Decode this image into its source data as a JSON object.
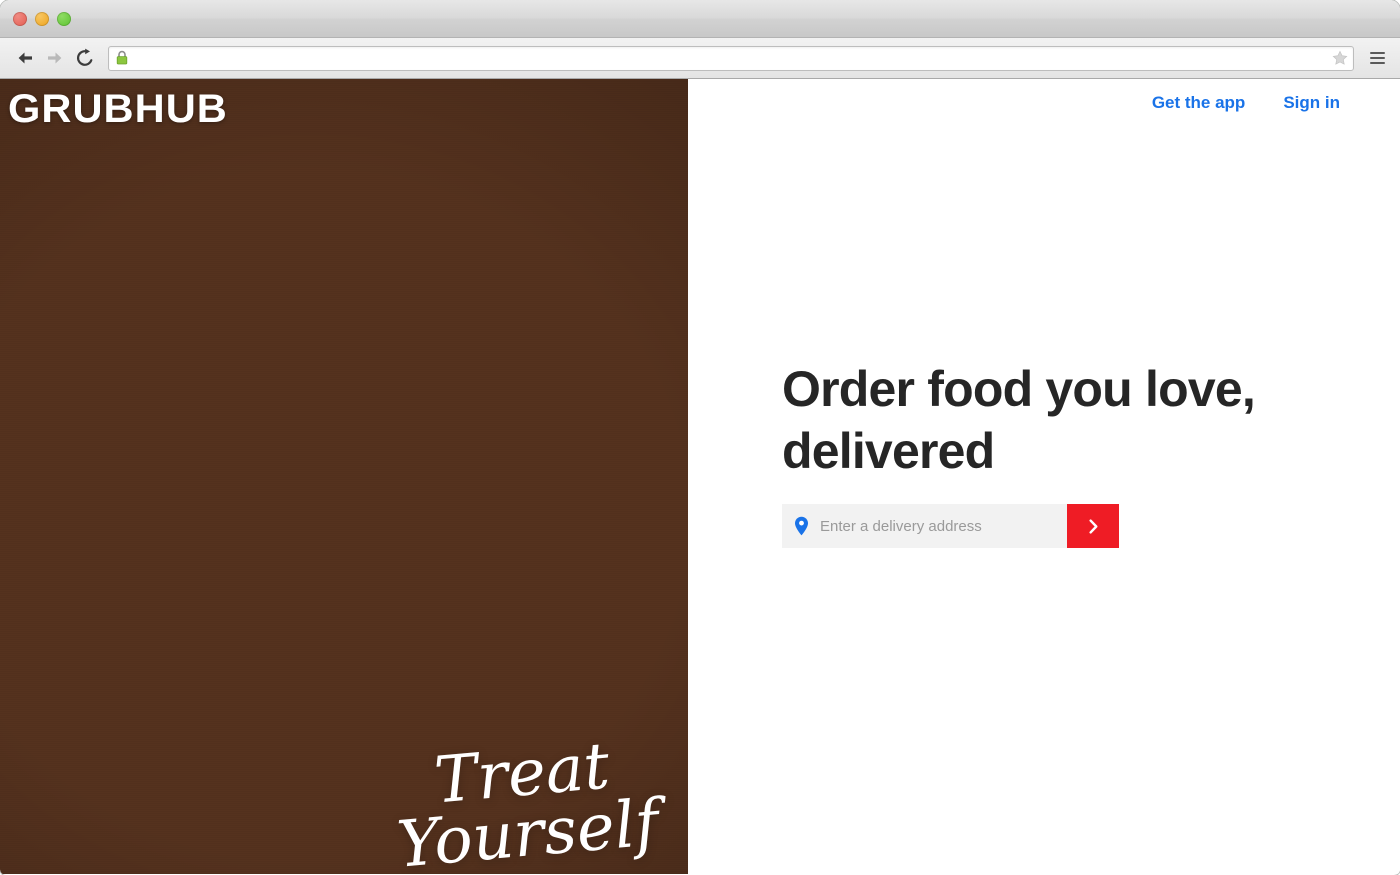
{
  "browser": {
    "traffic_lights": [
      "close",
      "minimize",
      "maximize"
    ],
    "back_icon": "back-arrow-icon",
    "forward_icon": "forward-arrow-icon",
    "reload_icon": "reload-icon",
    "lock_icon": "secure-lock-icon",
    "url": "",
    "url_placeholder": "",
    "bookmark_icon": "star-icon",
    "menu_icon": "hamburger-menu-icon"
  },
  "site": {
    "logo_text": "GRUBHUB",
    "hero_script_line1": "Treat",
    "hero_script_line2": "Yourself",
    "nav": [
      {
        "label": "Get the app",
        "name": "nav-get-the-app"
      },
      {
        "label": "Sign in",
        "name": "nav-sign-in"
      }
    ],
    "headline": "Order food you love,\ndelivered",
    "address": {
      "placeholder": "Enter a delivery address",
      "value": "",
      "pin_icon": "location-pin-icon",
      "submit_icon": "chevron-right-icon"
    }
  },
  "colors": {
    "link_blue": "#1a73e8",
    "pin_blue": "#1a73e8",
    "submit_red": "#ef1c25",
    "headline_dark": "#262626",
    "input_bg": "#f2f2f2"
  }
}
